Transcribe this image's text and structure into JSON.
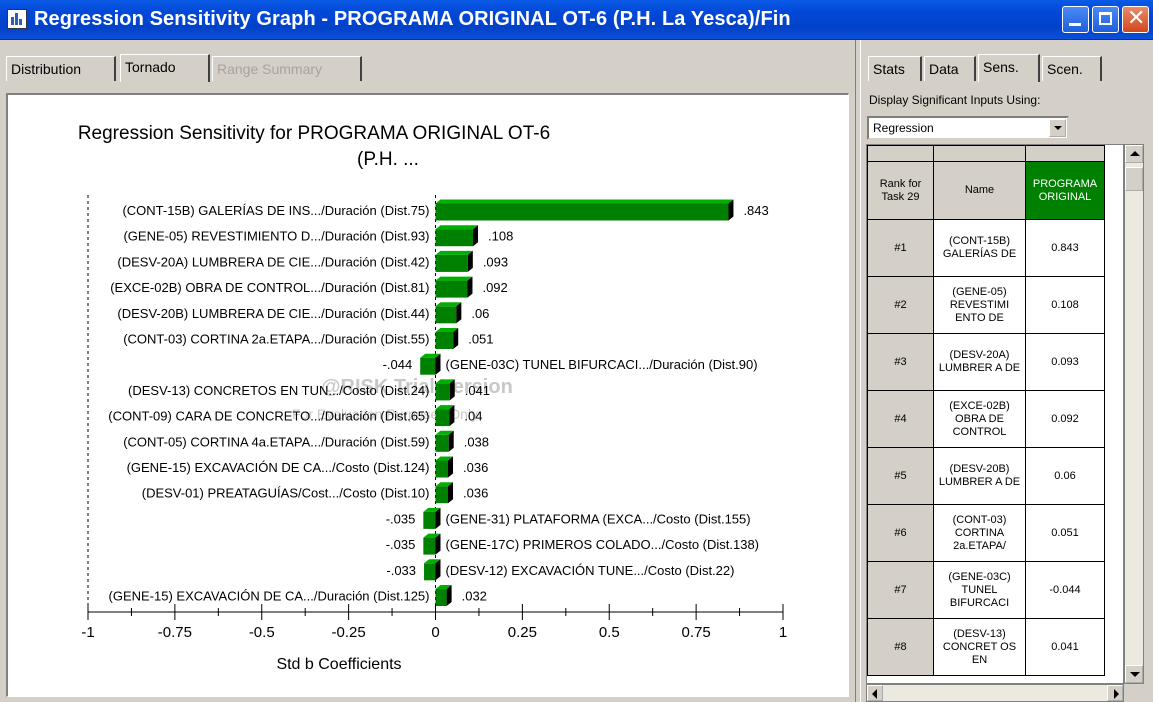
{
  "window": {
    "title": "Regression Sensitivity Graph - PROGRAMA ORIGINAL OT-6 (P.H. La Yesca)/Fin"
  },
  "left_tabs": [
    {
      "label": "Distribution",
      "state": "normal"
    },
    {
      "label": "Tornado",
      "state": "active"
    },
    {
      "label": "Range Summary",
      "state": "disabled"
    }
  ],
  "right_tabs": [
    {
      "label": "Stats"
    },
    {
      "label": "Data"
    },
    {
      "label": "Sens."
    },
    {
      "label": "Scen."
    }
  ],
  "display_label": "Display Significant Inputs Using:",
  "select_value": "Regression",
  "watermark": {
    "line1": "@RISK Trial Version",
    "line2": "For Evaluation Purposes Only"
  },
  "chart_data": {
    "type": "bar",
    "orientation": "horizontal",
    "title": "Regression Sensitivity for PROGRAMA ORIGINAL OT-6",
    "subtitle": "(P.H. ...",
    "xlabel": "Std b Coefficients",
    "xlim": [
      -1,
      1
    ],
    "xticks": [
      "-1",
      "-0.75",
      "-0.5",
      "-0.25",
      "0",
      "0.25",
      "0.5",
      "0.75",
      "1"
    ],
    "bar_color": "#008000",
    "categories": [
      "(CONT-15B) GALERÍAS DE INS.../Duración (Dist.75)",
      "(GENE-05) REVESTIMIENTO  D.../Duración (Dist.93)",
      "(DESV-20A) LUMBRERA DE CIE.../Duración (Dist.42)",
      "(EXCE-02B) OBRA DE CONTROL.../Duración (Dist.81)",
      "(DESV-20B) LUMBRERA DE CIE.../Duración (Dist.44)",
      "(CONT-03) CORTINA 2a.ETAPA.../Duración (Dist.55)",
      "(GENE-03C) TUNEL BIFURCACI.../Duración (Dist.90)",
      "(DESV-13) CONCRETOS EN TUN.../Costo (Dist.24)",
      "(CONT-09) CARA DE CONCRETO.../Duración (Dist.65)",
      "(CONT-05) CORTINA 4a.ETAPA.../Duración (Dist.59)",
      "(GENE-15) EXCAVACIÓN DE CA.../Costo (Dist.124)",
      "(DESV-01) PREATAGUÍAS/Cost.../Costo (Dist.10)",
      "(GENE-31) PLATAFORMA (EXCA.../Costo (Dist.155)",
      "(GENE-17C) PRIMEROS COLADO.../Costo (Dist.138)",
      "(DESV-12)  EXCAVACIÓN TUNE.../Costo (Dist.22)",
      "(GENE-15) EXCAVACIÓN DE CA.../Duración (Dist.125)"
    ],
    "values": [
      0.843,
      0.108,
      0.093,
      0.092,
      0.06,
      0.051,
      -0.044,
      0.041,
      0.04,
      0.038,
      0.036,
      0.036,
      -0.035,
      -0.035,
      -0.033,
      0.032
    ],
    "value_labels": [
      ".843",
      ".108",
      ".093",
      ".092",
      ".06",
      ".051",
      "-.044",
      ".041",
      ".04",
      ".038",
      ".036",
      ".036",
      "-.035",
      "-.035",
      "-.033",
      ".032"
    ]
  },
  "table": {
    "headers": [
      "Rank for Task 29",
      "Name",
      "PROGRAMA ORIGINAL"
    ],
    "header_accent": "#008000",
    "rows": [
      {
        "rank": "#1",
        "name": "(CONT-15B) GALERÍAS DE",
        "value": "0.843"
      },
      {
        "rank": "#2",
        "name": "(GENE-05) REVESTIMI ENTO DE",
        "value": "0.108"
      },
      {
        "rank": "#3",
        "name": "(DESV-20A) LUMBRER A DE",
        "value": "0.093"
      },
      {
        "rank": "#4",
        "name": "(EXCE-02B) OBRA DE CONTROL",
        "value": "0.092"
      },
      {
        "rank": "#5",
        "name": "(DESV-20B) LUMBRER A DE",
        "value": "0.06"
      },
      {
        "rank": "#6",
        "name": "(CONT-03) CORTINA 2a.ETAPA/",
        "value": "0.051"
      },
      {
        "rank": "#7",
        "name": "(GENE-03C) TUNEL BIFURCACI",
        "value": "-0.044"
      },
      {
        "rank": "#8",
        "name": "(DESV-13) CONCRET OS EN",
        "value": "0.041"
      }
    ]
  }
}
